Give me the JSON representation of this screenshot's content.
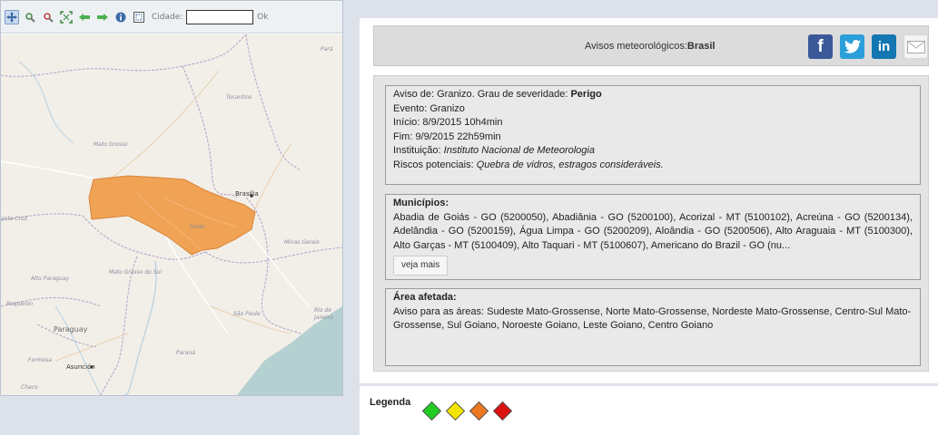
{
  "map": {
    "toolbar": {
      "city_label": "Cidade:",
      "city_value": "",
      "ok_label": "Ok"
    },
    "labels": {
      "para": "Pará",
      "tocantins": "Tocantins",
      "mato_grosso": "Mato Grosso",
      "brasilia": "Brasília",
      "santa_cruz": "anta Cruz",
      "goias": "Goiás",
      "minas_gerais": "Minas Gerais",
      "mato_grosso_do_sul": "Mato Grosso do Sul",
      "alto_paraguay": "Alto Paraguay",
      "boqueron": "Boquerón",
      "sao_paulo": "São Paulo",
      "rio_de_janeiro": "Rio de Janeiro",
      "parana": "Paraná",
      "paraguay": "Paraguay",
      "formosa": "Formosa",
      "asuncion": "Asunción",
      "chaco": "Chaco"
    },
    "colors": {
      "alert_area": "#f0a355",
      "alert_border": "#d9843a",
      "sea": "#b5d0d0",
      "border": "#b8a9c9",
      "road": "#ffffff"
    }
  },
  "header": {
    "title_prefix": "Avisos meteorológicos:",
    "title_region": "Brasil",
    "share": {
      "facebook": "f",
      "twitter": "t",
      "linkedin": "in"
    }
  },
  "warning": {
    "line1_prefix": "Aviso de: Granizo. Grau de severidade: ",
    "severity": "Perigo",
    "event": "Evento: Granizo",
    "start": "Início: 8/9/2015 10h4min",
    "end": "Fim: 9/9/2015 22h59min",
    "institution_label": "Instituição: ",
    "institution": "Instituto Nacional de Meteorologia",
    "risks_label": "Riscos potenciais: ",
    "risks": "Quebra de vidros, estragos consideráveis."
  },
  "municipalities": {
    "title": "Municípios:",
    "text": "Abadia de Goiás - GO (5200050), Abadiânia - GO (5200100), Acorizal - MT (5100102), Acreúna - GO (5200134), Adelândia - GO (5200159), Água Limpa - GO (5200209), Aloândia - GO (5200506), Alto Araguaia - MT (5100300), Alto Garças - MT (5100409), Alto Taquari - MT (5100607), Americano do Brazil - GO (nu...",
    "more_label": "veja mais"
  },
  "area": {
    "title": "Área afetada:",
    "text": "Aviso para as áreas: Sudeste Mato-Grossense, Norte Mato-Grossense, Nordeste Mato-Grossense, Centro-Sul Mato-Grossense, Sul Goiano, Noroeste Goiano, Leste Goiano, Centro Goiano"
  },
  "legend": {
    "title": "Legenda",
    "colors": [
      "#22cc22",
      "#f2e600",
      "#ee7722",
      "#dd1111"
    ]
  }
}
